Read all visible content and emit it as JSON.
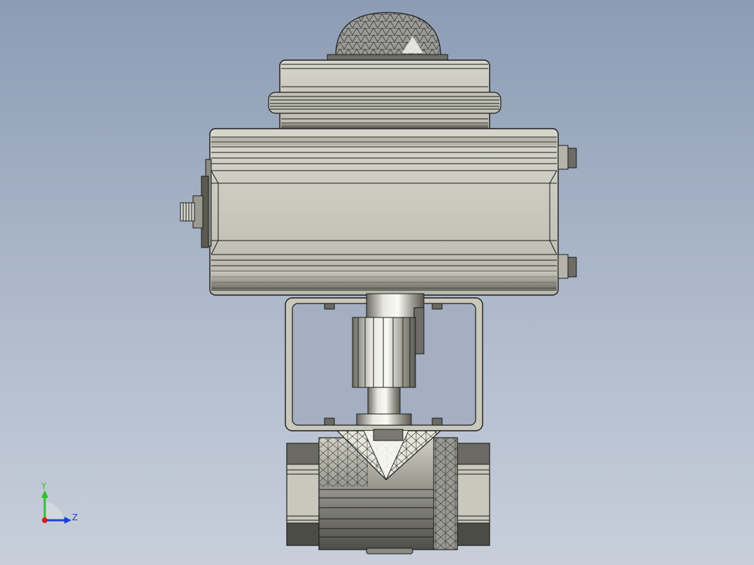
{
  "viewport": {
    "background_top": "#8c9cb4",
    "background_bottom": "#c8cfdb"
  },
  "model": {
    "name": "",
    "body_color": "#c8c8bc",
    "edge_color": "#1a1a1a",
    "dark_shade": "#5a5a52"
  },
  "triad": {
    "y_label": "Y",
    "z_label": "Z",
    "x_color": "#d81e1e",
    "y_color": "#2fbf2f",
    "z_color": "#1e3ed8"
  }
}
